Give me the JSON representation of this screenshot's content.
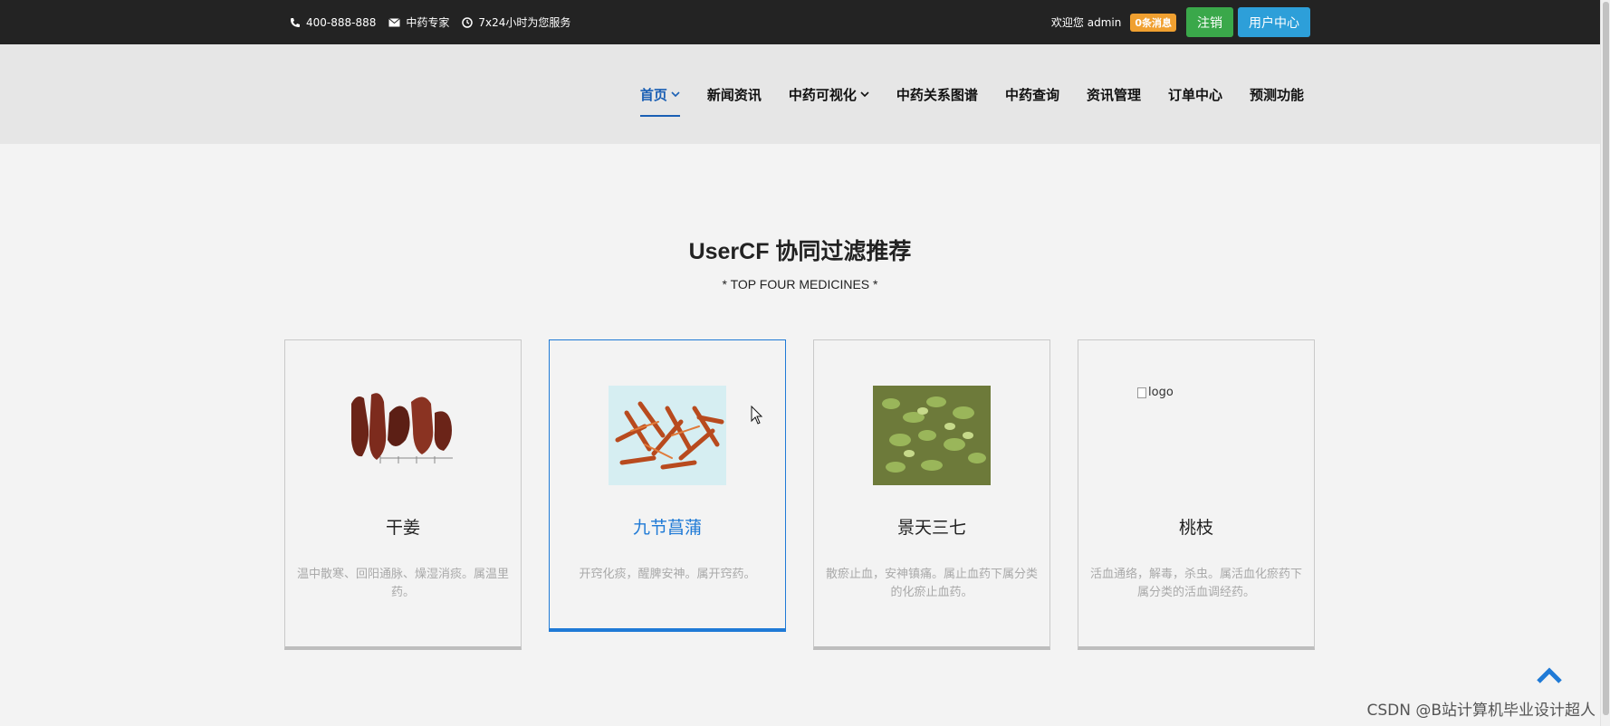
{
  "topbar": {
    "phone": "400-888-888",
    "expert": "中药专家",
    "service": "7x24小时为您服务",
    "welcome": "欢迎您 admin",
    "messages": "0条消息",
    "logout": "注销",
    "user_center": "用户中心"
  },
  "nav": {
    "items": [
      {
        "label": "首页",
        "active": true,
        "dropdown": true
      },
      {
        "label": "新闻资讯"
      },
      {
        "label": "中药可视化",
        "dropdown": true
      },
      {
        "label": "中药关系图谱"
      },
      {
        "label": "中药查询"
      },
      {
        "label": "资讯管理"
      },
      {
        "label": "订单中心"
      },
      {
        "label": "预测功能"
      }
    ]
  },
  "section": {
    "title": "UserCF 协同过滤推荐",
    "subtitle": "* TOP FOUR MEDICINES *"
  },
  "cards": [
    {
      "name": "干姜",
      "desc": "温中散寒、回阳通脉、燥湿消痰。属温里药。"
    },
    {
      "name": "九节菖蒲",
      "desc": "开窍化痰，醒脾安神。属开窍药。"
    },
    {
      "name": "景天三七",
      "desc": "散瘀止血，安神镇痛。属止血药下属分类的化瘀止血药。"
    },
    {
      "name": "桃枝",
      "desc": "活血通络，解毒，杀虫。属活血化瘀药下属分类的活血调经药。",
      "img_alt": "logo"
    }
  ],
  "watermark": "CSDN @B站计算机毕业设计超人",
  "colors": {
    "accent": "#1f7ad6",
    "topbar": "#232323",
    "green": "#3aa84a",
    "blue": "#2d9fd9",
    "badge": "#f0a030"
  }
}
